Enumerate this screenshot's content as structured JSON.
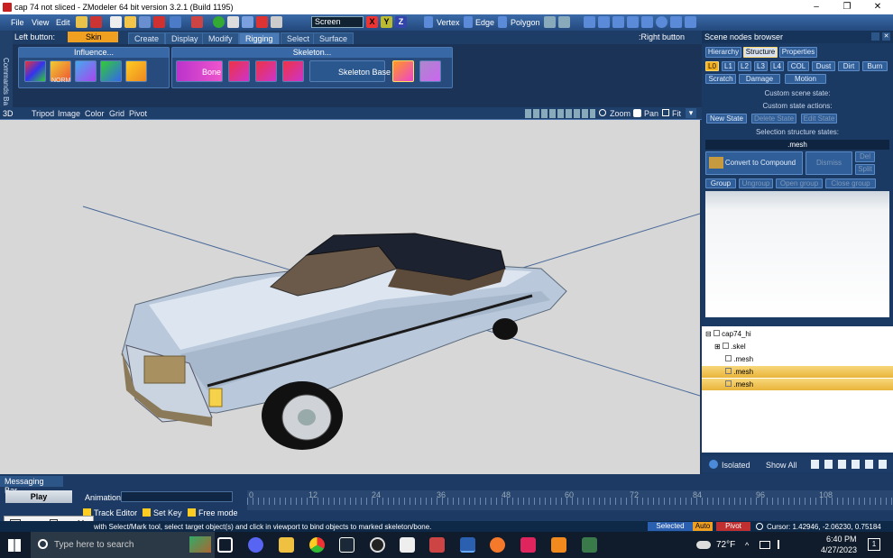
{
  "window": {
    "title": "cap 74 not sliced - ZModeler 64 bit version 3.2.1 (Build 1195)",
    "minimize": "–",
    "maximize": "❐",
    "close": "✕"
  },
  "menu": {
    "file": "File",
    "view": "View",
    "edit": "Edit",
    "screen": "Screen",
    "vertex": "Vertex",
    "edge": "Edge",
    "polygon": "Polygon"
  },
  "mode": {
    "left_button": "Left button:",
    "skin_bind": "Skin Bind",
    "right_button": ":Right button"
  },
  "tabs": [
    "Create",
    "Display",
    "Modify",
    "Rigging",
    "Select",
    "Surface"
  ],
  "ribbon": {
    "influence_title": "Influence...",
    "skeleton_title": "Skeleton...",
    "norm": "NORM",
    "bone": "Bone",
    "skeleton_base": "Skeleton Base"
  },
  "leftbar": {
    "label": "Commands Ba"
  },
  "viewport_bar": {
    "mode": "3D",
    "tripod": "Tripod",
    "image": "Image",
    "color": "Color",
    "grid": "Grid",
    "pivot": "Pivot",
    "zoom": "Zoom",
    "pan": "Pan",
    "fit": "Fit"
  },
  "scene_browser": {
    "title": "Scene nodes browser",
    "tabs": [
      "Hierarchy",
      "Structure",
      "Properties"
    ],
    "levels": [
      "L0",
      "L1",
      "L2",
      "L3",
      "L4",
      "COL",
      "Dust",
      "Dirt",
      "Burn"
    ],
    "scratch": "Scratch",
    "damage": "Damage",
    "motion": "Motion",
    "custom_scene_state": "Custom scene state:",
    "custom_state_actions": "Custom state actions:",
    "new_state": "New State",
    "delete_state": "Delete State",
    "edit_state": "Edit State",
    "selection_states": "Selection structure states:",
    "mesh_value": ".mesh",
    "convert": "Convert to Compound",
    "dismiss": "Dismiss",
    "del": "Del",
    "split": "Split",
    "group": "Group",
    "ungroup": "Ungroup",
    "open_group": "Open group",
    "close_group": "Close group"
  },
  "tree": {
    "root": "cap74_hi",
    "items": [
      ".skel",
      ".mesh",
      ".mesh",
      ".mesh"
    ]
  },
  "tree_footer": {
    "isolated": "Isolated",
    "show_all": "Show All"
  },
  "messaging": {
    "title": "Messaging Bar",
    "play": "Play",
    "animation": "Animation:",
    "track_editor": "Track Editor",
    "set_key": "Set Key",
    "free_mode": "Free mode",
    "timeline_ticks": [
      "0",
      "12",
      "24",
      "36",
      "48",
      "60",
      "72",
      "84",
      "96",
      "108"
    ]
  },
  "status": {
    "message": "with Select/Mark tool, select target object(s) and click in viewport to bind objects to marked skeleton/bone.",
    "selected": "Selected",
    "auto": "Auto",
    "pivot": "Pivot",
    "cursor": "Cursor: 1.42946, -2.06230, 0.75184"
  },
  "taskbar": {
    "search_placeholder": "Type here to search",
    "weather": "72°F",
    "time": "6:40 PM",
    "date": "4/27/2023",
    "notifications": "1"
  }
}
